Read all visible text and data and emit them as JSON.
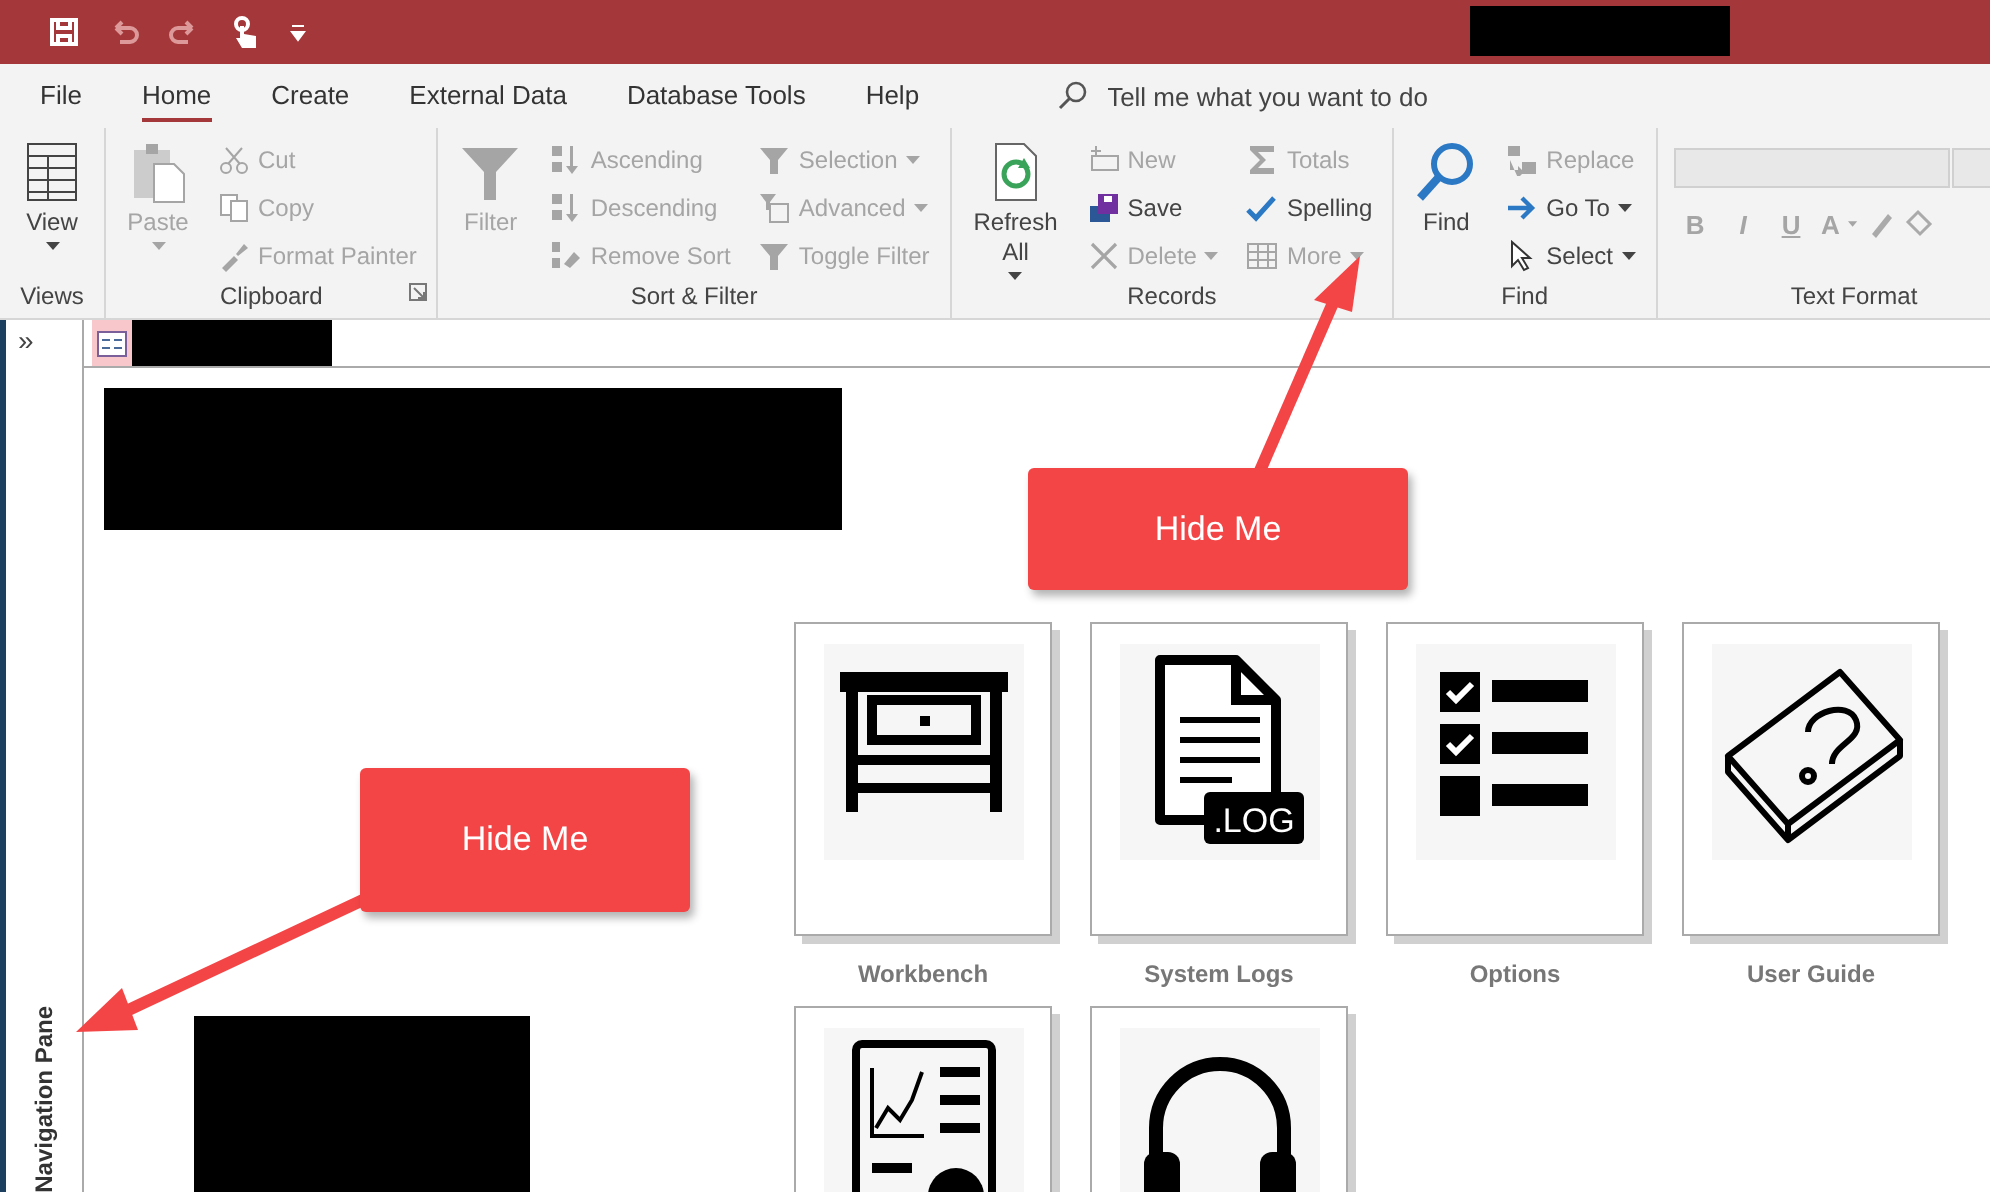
{
  "menu_tabs": [
    {
      "label": "File",
      "selected": false
    },
    {
      "label": "Home",
      "selected": true
    },
    {
      "label": "Create",
      "selected": false
    },
    {
      "label": "External Data",
      "selected": false
    },
    {
      "label": "Database Tools",
      "selected": false
    },
    {
      "label": "Help",
      "selected": false
    }
  ],
  "tell_me": {
    "placeholder": "Tell me what you want to do"
  },
  "ribbon": {
    "groups": [
      {
        "label": "Views",
        "launcher": false,
        "items": [
          {
            "kind": "large",
            "label": "View",
            "disabled": false,
            "dropdown": true
          }
        ]
      },
      {
        "label": "Clipboard",
        "launcher": true,
        "items": [
          {
            "kind": "large",
            "label": "Paste",
            "disabled": true,
            "dropdown": true
          },
          {
            "kind": "small",
            "label": "Cut",
            "disabled": true,
            "dropdown": false
          },
          {
            "kind": "small",
            "label": "Copy",
            "disabled": true,
            "dropdown": false
          },
          {
            "kind": "small",
            "label": "Format Painter",
            "disabled": true,
            "dropdown": false
          }
        ]
      },
      {
        "label": "Sort & Filter",
        "launcher": false,
        "items": [
          {
            "kind": "large",
            "label": "Filter",
            "disabled": true,
            "dropdown": false
          },
          {
            "kind": "small",
            "label": "Ascending",
            "disabled": true,
            "dropdown": false
          },
          {
            "kind": "small",
            "label": "Descending",
            "disabled": true,
            "dropdown": false
          },
          {
            "kind": "small",
            "label": "Remove Sort",
            "disabled": true,
            "dropdown": false
          },
          {
            "kind": "small",
            "label": "Selection",
            "disabled": true,
            "dropdown": true
          },
          {
            "kind": "small",
            "label": "Advanced",
            "disabled": true,
            "dropdown": true
          },
          {
            "kind": "small",
            "label": "Toggle Filter",
            "disabled": true,
            "dropdown": false
          }
        ]
      },
      {
        "label": "Records",
        "launcher": false,
        "items": [
          {
            "kind": "large",
            "label": "Refresh All",
            "disabled": false,
            "dropdown": true
          },
          {
            "kind": "small",
            "label": "New",
            "disabled": true,
            "dropdown": false
          },
          {
            "kind": "small",
            "label": "Save",
            "disabled": false,
            "dropdown": false
          },
          {
            "kind": "small",
            "label": "Delete",
            "disabled": true,
            "dropdown": true
          },
          {
            "kind": "small",
            "label": "Totals",
            "disabled": true,
            "dropdown": false
          },
          {
            "kind": "small",
            "label": "Spelling",
            "disabled": false,
            "dropdown": false
          },
          {
            "kind": "small",
            "label": "More",
            "disabled": true,
            "dropdown": true
          }
        ]
      },
      {
        "label": "Find",
        "launcher": false,
        "items": [
          {
            "kind": "large",
            "label": "Find",
            "disabled": false,
            "dropdown": false
          },
          {
            "kind": "small",
            "label": "Replace",
            "disabled": true,
            "dropdown": false
          },
          {
            "kind": "small",
            "label": "Go To",
            "disabled": false,
            "dropdown": true
          },
          {
            "kind": "small",
            "label": "Select",
            "disabled": false,
            "dropdown": true
          }
        ]
      },
      {
        "label": "Text Format",
        "launcher": false,
        "items": [
          {
            "kind": "format",
            "label": "B",
            "disabled": true,
            "dropdown": false
          },
          {
            "kind": "format",
            "label": "I",
            "disabled": true,
            "dropdown": false
          },
          {
            "kind": "format",
            "label": "U",
            "disabled": true,
            "dropdown": false
          },
          {
            "kind": "format",
            "label": "A",
            "disabled": true,
            "dropdown": true
          }
        ]
      }
    ]
  },
  "navigation_pane": {
    "label": "Navigation Pane",
    "expand": "»"
  },
  "tiles": [
    {
      "label": "Workbench"
    },
    {
      "label": "System Logs",
      "badge": ".LOG"
    },
    {
      "label": "Options"
    },
    {
      "label": "User Guide"
    },
    {
      "kind": "icon"
    },
    {
      "kind": "icon"
    }
  ],
  "callouts": [
    {
      "text": "Hide Me"
    },
    {
      "text": "Hide Me"
    }
  ]
}
